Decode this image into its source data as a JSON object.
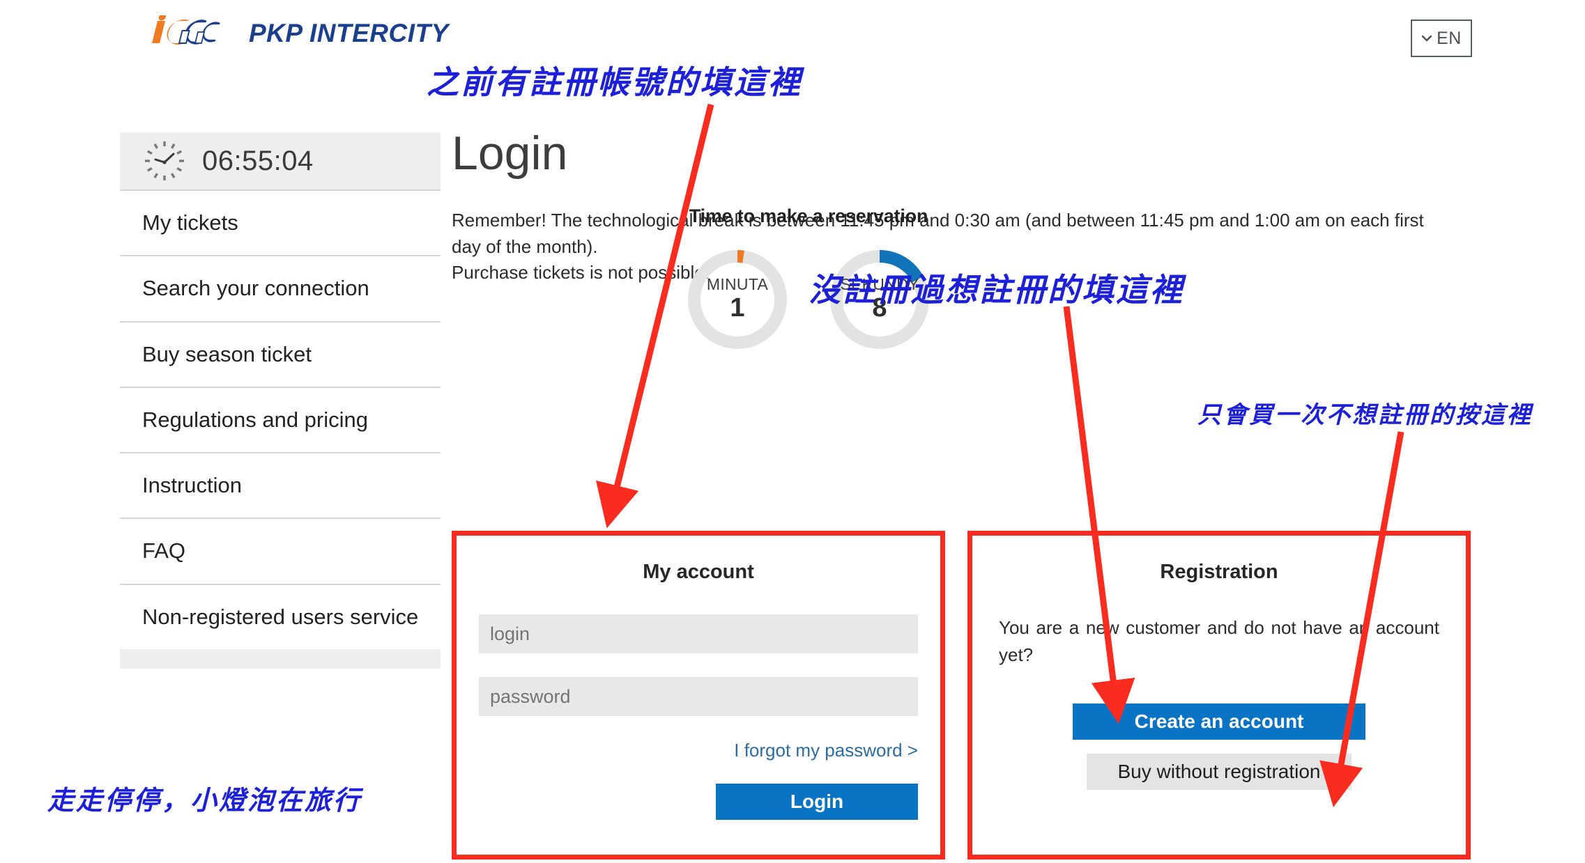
{
  "header": {
    "logo_mark": "ic-logo-icon",
    "logo_text": "PKP INTERCITY",
    "language": {
      "icon": "chevron-down-icon",
      "value": "EN"
    }
  },
  "sidebar": {
    "clock": {
      "icon": "clock-icon",
      "time": "06:55:04"
    },
    "items": [
      {
        "label": "My tickets"
      },
      {
        "label": "Search your connection"
      },
      {
        "label": "Buy season ticket"
      },
      {
        "label": "Regulations and pricing"
      },
      {
        "label": "Instruction"
      },
      {
        "label": "FAQ"
      },
      {
        "label": "Non-registered users service"
      }
    ]
  },
  "main": {
    "title": "Login",
    "notice_line1": "Remember! The technological break is between 11:45 pm and 0:30 am (and between 11:45 pm and 1:00 am on each first day of the month).",
    "notice_line2": "Purchase tickets is not possible."
  },
  "reservation": {
    "title": "Time to make a reservation",
    "dials": [
      {
        "label": "MINUTA",
        "value": "1",
        "color": "#f07a22",
        "progress_deg": 8
      },
      {
        "label": "SEKUNDY",
        "value": "8",
        "color": "#1274b8",
        "progress_deg": 62
      }
    ],
    "track_color": "#e3e3e3"
  },
  "account_panel": {
    "title": "My account",
    "login_placeholder": "login",
    "password_placeholder": "password",
    "login_value": "",
    "password_value": "",
    "forgot_label": "I forgot my password >",
    "submit_label": "Login"
  },
  "registration_panel": {
    "title": "Registration",
    "description": "You are a new customer and do not have an account yet?",
    "create_label": "Create an account",
    "buy_label": "Buy without registration"
  },
  "annotations": {
    "callout_1": "之前有註冊帳號的填這裡",
    "callout_2": "沒註冊過想註冊的填這裡",
    "callout_3": "只會買一次不想註冊的按這裡",
    "watermark": "走走停停，小燈泡在旅行",
    "ink_color": "#1c20d8",
    "arrow_color": "#fa2c20"
  }
}
